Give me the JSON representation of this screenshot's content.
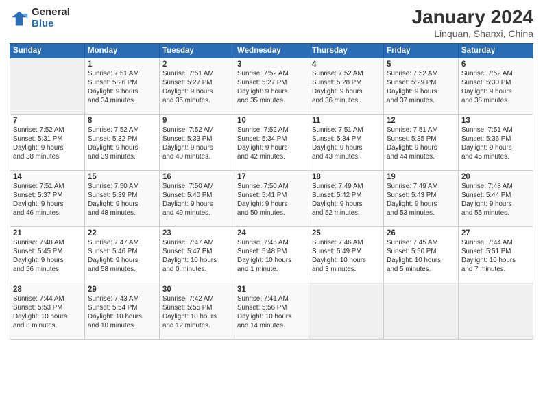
{
  "header": {
    "logo_general": "General",
    "logo_blue": "Blue",
    "title": "January 2024",
    "subtitle": "Linquan, Shanxi, China"
  },
  "days_of_week": [
    "Sunday",
    "Monday",
    "Tuesday",
    "Wednesday",
    "Thursday",
    "Friday",
    "Saturday"
  ],
  "weeks": [
    [
      {
        "num": "",
        "info": ""
      },
      {
        "num": "1",
        "info": "Sunrise: 7:51 AM\nSunset: 5:26 PM\nDaylight: 9 hours\nand 34 minutes."
      },
      {
        "num": "2",
        "info": "Sunrise: 7:51 AM\nSunset: 5:27 PM\nDaylight: 9 hours\nand 35 minutes."
      },
      {
        "num": "3",
        "info": "Sunrise: 7:52 AM\nSunset: 5:27 PM\nDaylight: 9 hours\nand 35 minutes."
      },
      {
        "num": "4",
        "info": "Sunrise: 7:52 AM\nSunset: 5:28 PM\nDaylight: 9 hours\nand 36 minutes."
      },
      {
        "num": "5",
        "info": "Sunrise: 7:52 AM\nSunset: 5:29 PM\nDaylight: 9 hours\nand 37 minutes."
      },
      {
        "num": "6",
        "info": "Sunrise: 7:52 AM\nSunset: 5:30 PM\nDaylight: 9 hours\nand 38 minutes."
      }
    ],
    [
      {
        "num": "7",
        "info": "Sunrise: 7:52 AM\nSunset: 5:31 PM\nDaylight: 9 hours\nand 38 minutes."
      },
      {
        "num": "8",
        "info": "Sunrise: 7:52 AM\nSunset: 5:32 PM\nDaylight: 9 hours\nand 39 minutes."
      },
      {
        "num": "9",
        "info": "Sunrise: 7:52 AM\nSunset: 5:33 PM\nDaylight: 9 hours\nand 40 minutes."
      },
      {
        "num": "10",
        "info": "Sunrise: 7:52 AM\nSunset: 5:34 PM\nDaylight: 9 hours\nand 42 minutes."
      },
      {
        "num": "11",
        "info": "Sunrise: 7:51 AM\nSunset: 5:34 PM\nDaylight: 9 hours\nand 43 minutes."
      },
      {
        "num": "12",
        "info": "Sunrise: 7:51 AM\nSunset: 5:35 PM\nDaylight: 9 hours\nand 44 minutes."
      },
      {
        "num": "13",
        "info": "Sunrise: 7:51 AM\nSunset: 5:36 PM\nDaylight: 9 hours\nand 45 minutes."
      }
    ],
    [
      {
        "num": "14",
        "info": "Sunrise: 7:51 AM\nSunset: 5:37 PM\nDaylight: 9 hours\nand 46 minutes."
      },
      {
        "num": "15",
        "info": "Sunrise: 7:50 AM\nSunset: 5:39 PM\nDaylight: 9 hours\nand 48 minutes."
      },
      {
        "num": "16",
        "info": "Sunrise: 7:50 AM\nSunset: 5:40 PM\nDaylight: 9 hours\nand 49 minutes."
      },
      {
        "num": "17",
        "info": "Sunrise: 7:50 AM\nSunset: 5:41 PM\nDaylight: 9 hours\nand 50 minutes."
      },
      {
        "num": "18",
        "info": "Sunrise: 7:49 AM\nSunset: 5:42 PM\nDaylight: 9 hours\nand 52 minutes."
      },
      {
        "num": "19",
        "info": "Sunrise: 7:49 AM\nSunset: 5:43 PM\nDaylight: 9 hours\nand 53 minutes."
      },
      {
        "num": "20",
        "info": "Sunrise: 7:48 AM\nSunset: 5:44 PM\nDaylight: 9 hours\nand 55 minutes."
      }
    ],
    [
      {
        "num": "21",
        "info": "Sunrise: 7:48 AM\nSunset: 5:45 PM\nDaylight: 9 hours\nand 56 minutes."
      },
      {
        "num": "22",
        "info": "Sunrise: 7:47 AM\nSunset: 5:46 PM\nDaylight: 9 hours\nand 58 minutes."
      },
      {
        "num": "23",
        "info": "Sunrise: 7:47 AM\nSunset: 5:47 PM\nDaylight: 10 hours\nand 0 minutes."
      },
      {
        "num": "24",
        "info": "Sunrise: 7:46 AM\nSunset: 5:48 PM\nDaylight: 10 hours\nand 1 minute."
      },
      {
        "num": "25",
        "info": "Sunrise: 7:46 AM\nSunset: 5:49 PM\nDaylight: 10 hours\nand 3 minutes."
      },
      {
        "num": "26",
        "info": "Sunrise: 7:45 AM\nSunset: 5:50 PM\nDaylight: 10 hours\nand 5 minutes."
      },
      {
        "num": "27",
        "info": "Sunrise: 7:44 AM\nSunset: 5:51 PM\nDaylight: 10 hours\nand 7 minutes."
      }
    ],
    [
      {
        "num": "28",
        "info": "Sunrise: 7:44 AM\nSunset: 5:53 PM\nDaylight: 10 hours\nand 8 minutes."
      },
      {
        "num": "29",
        "info": "Sunrise: 7:43 AM\nSunset: 5:54 PM\nDaylight: 10 hours\nand 10 minutes."
      },
      {
        "num": "30",
        "info": "Sunrise: 7:42 AM\nSunset: 5:55 PM\nDaylight: 10 hours\nand 12 minutes."
      },
      {
        "num": "31",
        "info": "Sunrise: 7:41 AM\nSunset: 5:56 PM\nDaylight: 10 hours\nand 14 minutes."
      },
      {
        "num": "",
        "info": ""
      },
      {
        "num": "",
        "info": ""
      },
      {
        "num": "",
        "info": ""
      }
    ]
  ]
}
